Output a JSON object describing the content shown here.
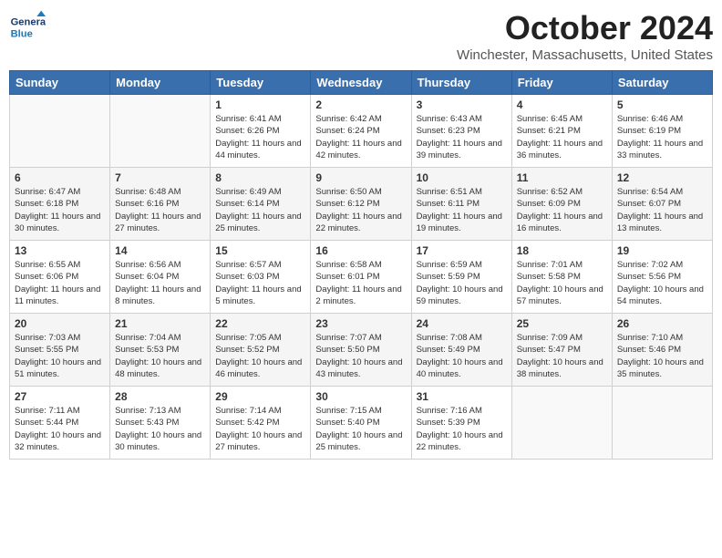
{
  "header": {
    "logo_general": "General",
    "logo_blue": "Blue",
    "month": "October 2024",
    "location": "Winchester, Massachusetts, United States"
  },
  "weekdays": [
    "Sunday",
    "Monday",
    "Tuesday",
    "Wednesday",
    "Thursday",
    "Friday",
    "Saturday"
  ],
  "weeks": [
    [
      {
        "day": "",
        "info": ""
      },
      {
        "day": "",
        "info": ""
      },
      {
        "day": "1",
        "info": "Sunrise: 6:41 AM\nSunset: 6:26 PM\nDaylight: 11 hours and 44 minutes."
      },
      {
        "day": "2",
        "info": "Sunrise: 6:42 AM\nSunset: 6:24 PM\nDaylight: 11 hours and 42 minutes."
      },
      {
        "day": "3",
        "info": "Sunrise: 6:43 AM\nSunset: 6:23 PM\nDaylight: 11 hours and 39 minutes."
      },
      {
        "day": "4",
        "info": "Sunrise: 6:45 AM\nSunset: 6:21 PM\nDaylight: 11 hours and 36 minutes."
      },
      {
        "day": "5",
        "info": "Sunrise: 6:46 AM\nSunset: 6:19 PM\nDaylight: 11 hours and 33 minutes."
      }
    ],
    [
      {
        "day": "6",
        "info": "Sunrise: 6:47 AM\nSunset: 6:18 PM\nDaylight: 11 hours and 30 minutes."
      },
      {
        "day": "7",
        "info": "Sunrise: 6:48 AM\nSunset: 6:16 PM\nDaylight: 11 hours and 27 minutes."
      },
      {
        "day": "8",
        "info": "Sunrise: 6:49 AM\nSunset: 6:14 PM\nDaylight: 11 hours and 25 minutes."
      },
      {
        "day": "9",
        "info": "Sunrise: 6:50 AM\nSunset: 6:12 PM\nDaylight: 11 hours and 22 minutes."
      },
      {
        "day": "10",
        "info": "Sunrise: 6:51 AM\nSunset: 6:11 PM\nDaylight: 11 hours and 19 minutes."
      },
      {
        "day": "11",
        "info": "Sunrise: 6:52 AM\nSunset: 6:09 PM\nDaylight: 11 hours and 16 minutes."
      },
      {
        "day": "12",
        "info": "Sunrise: 6:54 AM\nSunset: 6:07 PM\nDaylight: 11 hours and 13 minutes."
      }
    ],
    [
      {
        "day": "13",
        "info": "Sunrise: 6:55 AM\nSunset: 6:06 PM\nDaylight: 11 hours and 11 minutes."
      },
      {
        "day": "14",
        "info": "Sunrise: 6:56 AM\nSunset: 6:04 PM\nDaylight: 11 hours and 8 minutes."
      },
      {
        "day": "15",
        "info": "Sunrise: 6:57 AM\nSunset: 6:03 PM\nDaylight: 11 hours and 5 minutes."
      },
      {
        "day": "16",
        "info": "Sunrise: 6:58 AM\nSunset: 6:01 PM\nDaylight: 11 hours and 2 minutes."
      },
      {
        "day": "17",
        "info": "Sunrise: 6:59 AM\nSunset: 5:59 PM\nDaylight: 10 hours and 59 minutes."
      },
      {
        "day": "18",
        "info": "Sunrise: 7:01 AM\nSunset: 5:58 PM\nDaylight: 10 hours and 57 minutes."
      },
      {
        "day": "19",
        "info": "Sunrise: 7:02 AM\nSunset: 5:56 PM\nDaylight: 10 hours and 54 minutes."
      }
    ],
    [
      {
        "day": "20",
        "info": "Sunrise: 7:03 AM\nSunset: 5:55 PM\nDaylight: 10 hours and 51 minutes."
      },
      {
        "day": "21",
        "info": "Sunrise: 7:04 AM\nSunset: 5:53 PM\nDaylight: 10 hours and 48 minutes."
      },
      {
        "day": "22",
        "info": "Sunrise: 7:05 AM\nSunset: 5:52 PM\nDaylight: 10 hours and 46 minutes."
      },
      {
        "day": "23",
        "info": "Sunrise: 7:07 AM\nSunset: 5:50 PM\nDaylight: 10 hours and 43 minutes."
      },
      {
        "day": "24",
        "info": "Sunrise: 7:08 AM\nSunset: 5:49 PM\nDaylight: 10 hours and 40 minutes."
      },
      {
        "day": "25",
        "info": "Sunrise: 7:09 AM\nSunset: 5:47 PM\nDaylight: 10 hours and 38 minutes."
      },
      {
        "day": "26",
        "info": "Sunrise: 7:10 AM\nSunset: 5:46 PM\nDaylight: 10 hours and 35 minutes."
      }
    ],
    [
      {
        "day": "27",
        "info": "Sunrise: 7:11 AM\nSunset: 5:44 PM\nDaylight: 10 hours and 32 minutes."
      },
      {
        "day": "28",
        "info": "Sunrise: 7:13 AM\nSunset: 5:43 PM\nDaylight: 10 hours and 30 minutes."
      },
      {
        "day": "29",
        "info": "Sunrise: 7:14 AM\nSunset: 5:42 PM\nDaylight: 10 hours and 27 minutes."
      },
      {
        "day": "30",
        "info": "Sunrise: 7:15 AM\nSunset: 5:40 PM\nDaylight: 10 hours and 25 minutes."
      },
      {
        "day": "31",
        "info": "Sunrise: 7:16 AM\nSunset: 5:39 PM\nDaylight: 10 hours and 22 minutes."
      },
      {
        "day": "",
        "info": ""
      },
      {
        "day": "",
        "info": ""
      }
    ]
  ]
}
